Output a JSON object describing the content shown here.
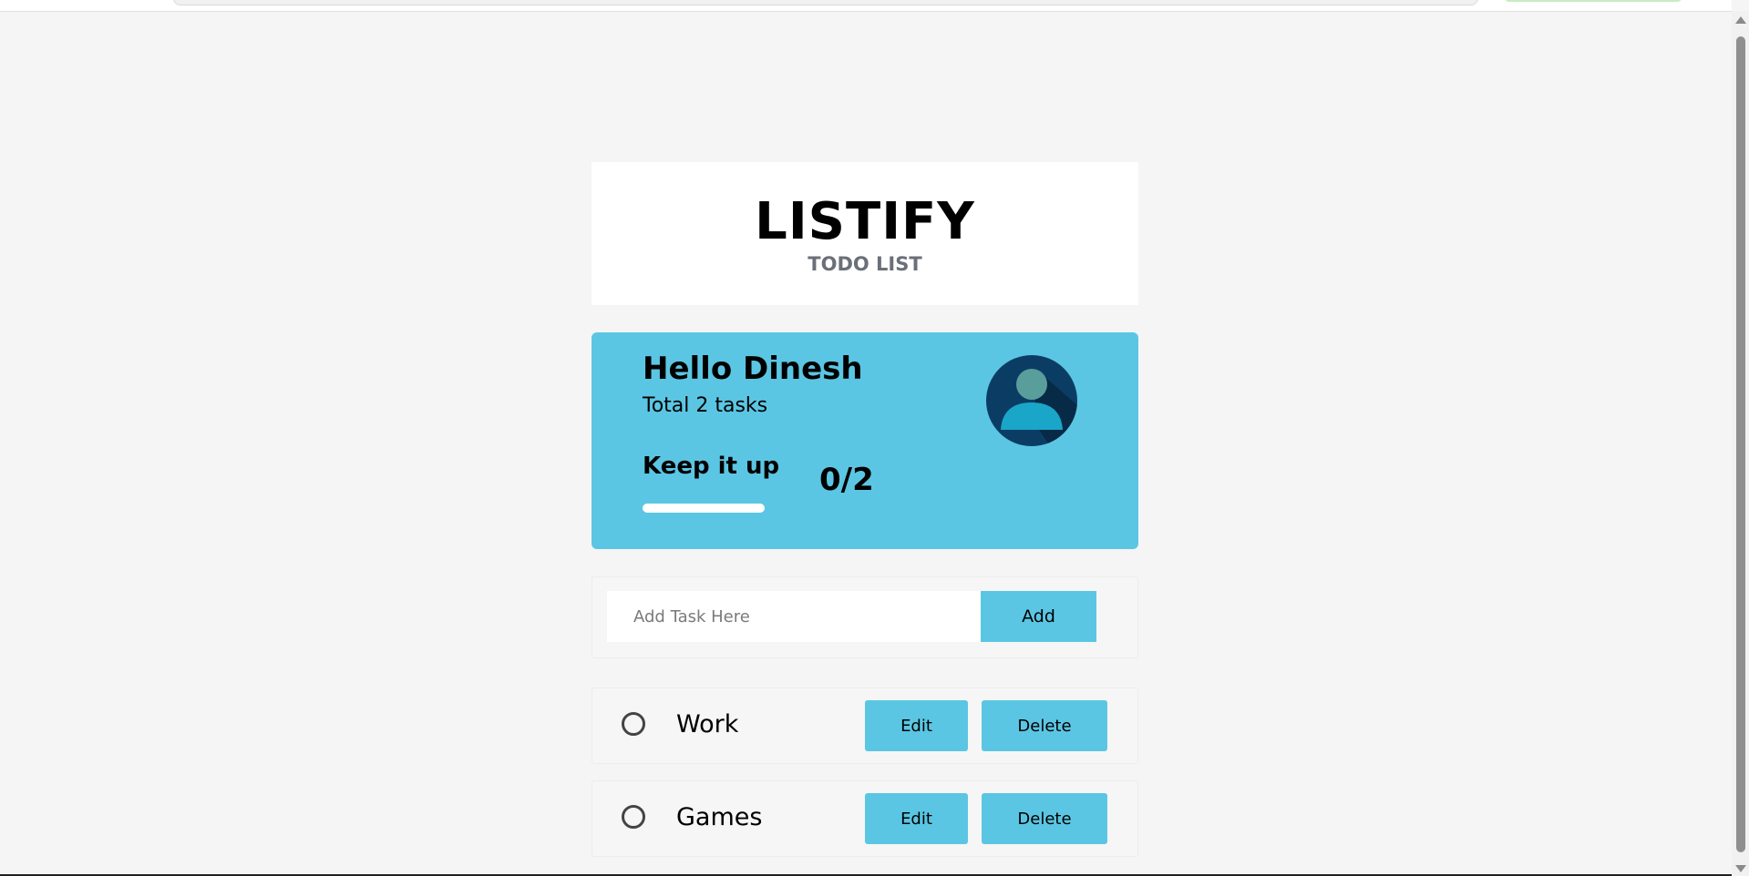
{
  "app": {
    "title": "LISTIFY",
    "subtitle": "TODO LIST"
  },
  "hero": {
    "greeting": "Hello Dinesh",
    "total_tasks": "Total 2 tasks",
    "motivation": "Keep it up",
    "progress_text": "0/2",
    "progress_fraction": 0,
    "avatar_icon": "user-avatar-icon"
  },
  "add_task": {
    "input_value": "",
    "placeholder": "Add Task Here",
    "button_label": "Add"
  },
  "tasks": [
    {
      "name": "Work",
      "completed": false,
      "edit_label": "Edit",
      "delete_label": "Delete"
    },
    {
      "name": "Games",
      "completed": false,
      "edit_label": "Edit",
      "delete_label": "Delete"
    }
  ],
  "colors": {
    "accent": "#5bc6e3",
    "background": "#f5f5f5",
    "avatar_bg": "#0b3d64",
    "avatar_figure": "#1aa6c8",
    "avatar_head": "#5a9e9c"
  }
}
